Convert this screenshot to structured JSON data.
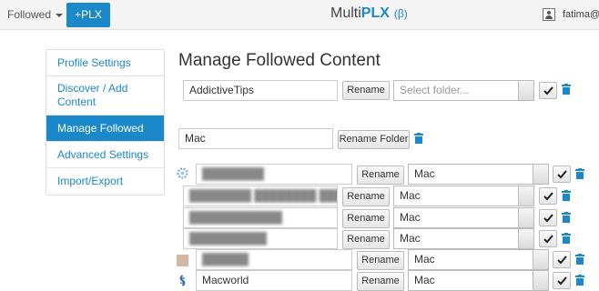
{
  "topbar": {
    "followed_label": "Followed",
    "plx_button": "+PLX",
    "brand_multi": "Multi",
    "brand_plx": "PLX",
    "brand_beta": "(β)",
    "user": "fatima@"
  },
  "sidebar": {
    "items": [
      {
        "label": "Profile Settings",
        "active": false
      },
      {
        "label": "Discover / Add Content",
        "active": false
      },
      {
        "label": "Manage Followed",
        "active": true
      },
      {
        "label": "Advanced Settings",
        "active": false
      },
      {
        "label": "Import/Export",
        "active": false
      }
    ]
  },
  "main": {
    "title": "Manage Followed Content",
    "rename_label": "Rename",
    "rename_folder_label": "Rename Folder",
    "first_row": {
      "name": "AddictiveTips",
      "folder_placeholder": "Select folder..."
    },
    "folder": {
      "name": "Mac"
    },
    "folder_items": [
      {
        "name": "████████",
        "folder": "Mac",
        "icon": "gear-feed-icon"
      },
      {
        "name": "████████ ████████ ███████ ███",
        "folder": "Mac",
        "icon": "none"
      },
      {
        "name": "████████████",
        "folder": "Mac",
        "icon": "none"
      },
      {
        "name": "██████████",
        "folder": "Mac",
        "icon": "none"
      }
    ],
    "other_items": [
      {
        "name": "██████",
        "folder": "Mac",
        "icon": "tan-square-icon"
      },
      {
        "name": "Macworld",
        "folder": "Mac",
        "icon": "rss-feed-icon"
      }
    ]
  }
}
